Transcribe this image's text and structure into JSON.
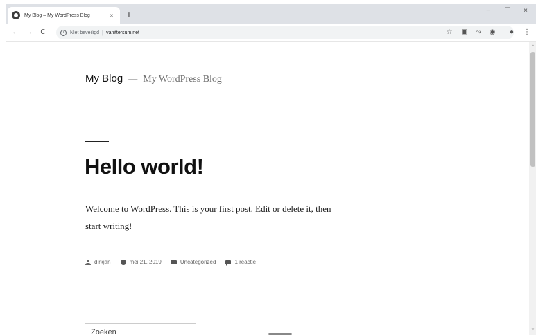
{
  "browser": {
    "tab_title": "My Blog – My WordPress Blog",
    "tab_close": "×",
    "new_tab": "+",
    "window_controls": {
      "minimize": "−",
      "maximize": "☐",
      "close": "×"
    },
    "nav": {
      "back": "←",
      "forward": "→",
      "reload": "C"
    },
    "address": {
      "security_text": "Niet beveiligd",
      "separator": "|",
      "url": "vanittersum.net"
    },
    "toolbar_icons": [
      "star-icon",
      "extension-icon",
      "sync-icon",
      "shield-icon",
      "profile-icon",
      "menu-icon"
    ]
  },
  "site": {
    "title": "My Blog",
    "dash": "—",
    "description": "My WordPress Blog"
  },
  "post": {
    "title": "Hello world!",
    "content": "Welcome to WordPress. This is your first post. Edit or delete it, then start writing!",
    "meta": {
      "author": "dirkjan",
      "date": "mei 21, 2019",
      "category": "Uncategorized",
      "comments": "1 reactie"
    }
  },
  "footer": {
    "search_peek": "Zoeken"
  }
}
